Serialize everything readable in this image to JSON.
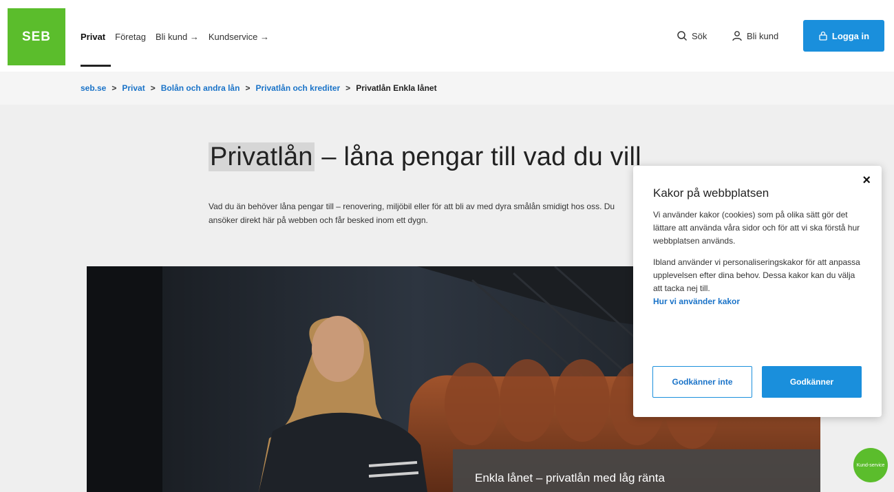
{
  "header": {
    "logo": "SEB",
    "nav": [
      {
        "label": "Privat"
      },
      {
        "label": "Företag"
      },
      {
        "label": "Bli kund →"
      },
      {
        "label": "Kundservice →"
      }
    ],
    "search_label": "Sök",
    "bli_kund_label": "Bli kund",
    "login_label": "Logga in"
  },
  "breadcrumb": {
    "items": [
      "seb.se",
      "Privat",
      "Bolån och andra lån",
      "Privatlån och krediter"
    ],
    "separator": ">",
    "current": "Privatlån Enkla lånet"
  },
  "hero": {
    "title_highlight": "Privatlån",
    "title_rest": " – låna pengar till vad du vill",
    "description": "Vad du än behöver låna pengar till – renovering, miljöbil eller för att bli av med dyra smålån smidigt hos oss. Du ansöker direkt här på webben och får besked inom ett dygn."
  },
  "photo_card": {
    "title": "Enkla lånet – privatlån med låg ränta"
  },
  "cookie": {
    "close": "×",
    "title": "Kakor på webbplatsen",
    "p1": "Vi använder kakor (cookies) som på olika sätt gör det lättare att använda våra sidor och för att vi ska förstå hur webbplatsen används.",
    "p2": "Ibland använder vi personaliseringskakor för att anpassa upplevelsen efter dina behov. Dessa kakor kan du välja att tacka nej till.",
    "link": "Hur vi använder kakor",
    "decline": "Godkänner inte",
    "accept": "Godkänner"
  },
  "kundservice_bubble": {
    "label": "Kund-service"
  },
  "colors": {
    "brand_green": "#5bbd2c",
    "primary_blue": "#1a8fdc",
    "link_blue": "#1a73c8"
  }
}
